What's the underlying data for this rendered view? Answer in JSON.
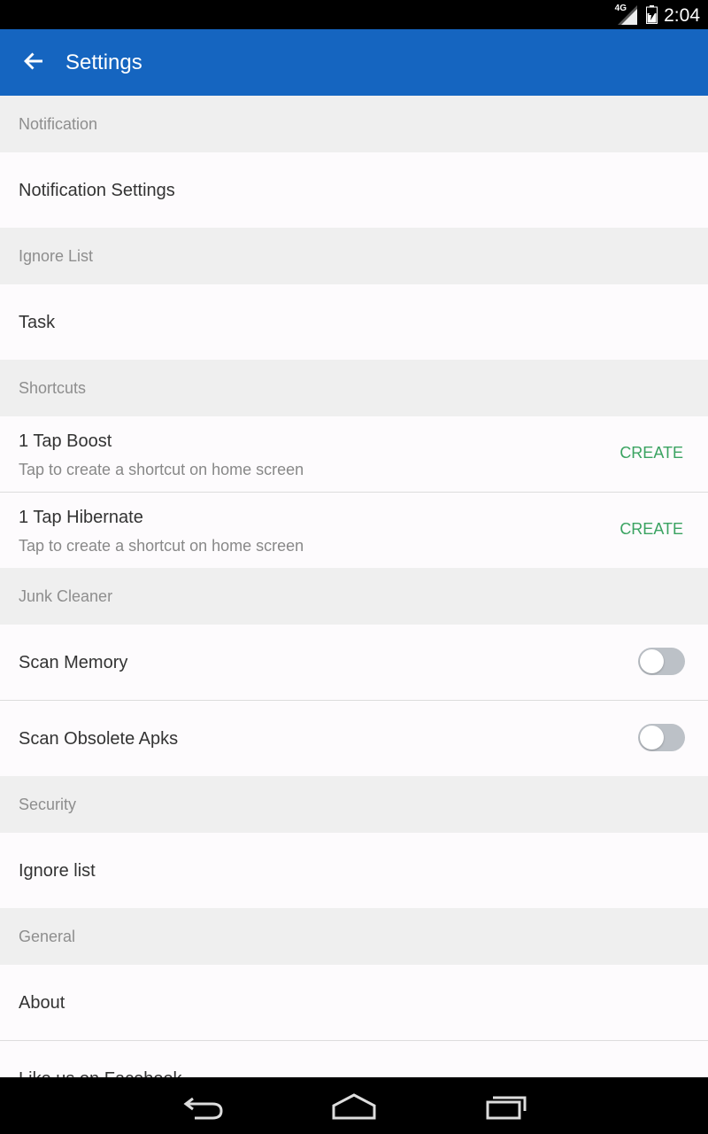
{
  "status_bar": {
    "network_type": "4G",
    "time": "2:04"
  },
  "app_bar": {
    "title": "Settings",
    "back_icon": "arrow-back-icon"
  },
  "sections": {
    "notification": {
      "header": "Notification",
      "item": "Notification Settings"
    },
    "ignore_list": {
      "header": "Ignore List",
      "item": "Task"
    },
    "shortcuts": {
      "header": "Shortcuts",
      "items": [
        {
          "title": "1 Tap Boost",
          "subtitle": "Tap to create a shortcut on home screen",
          "action": "CREATE"
        },
        {
          "title": "1 Tap Hibernate",
          "subtitle": "Tap to create a shortcut on home screen",
          "action": "CREATE"
        }
      ]
    },
    "junk_cleaner": {
      "header": "Junk Cleaner",
      "items": [
        {
          "label": "Scan Memory",
          "enabled": false
        },
        {
          "label": "Scan Obsolete Apks",
          "enabled": false
        }
      ]
    },
    "security": {
      "header": "Security",
      "item": "Ignore list"
    },
    "general": {
      "header": "General",
      "items": [
        "About",
        "Like us on Facebook"
      ]
    }
  },
  "colors": {
    "app_bar": "#1565c0",
    "action": "#3aa361",
    "section_bg": "#efefef",
    "toggle_off": "#bcc1c7"
  },
  "nav_bar": {
    "back": "back-icon",
    "home": "home-icon",
    "recents": "recents-icon"
  }
}
